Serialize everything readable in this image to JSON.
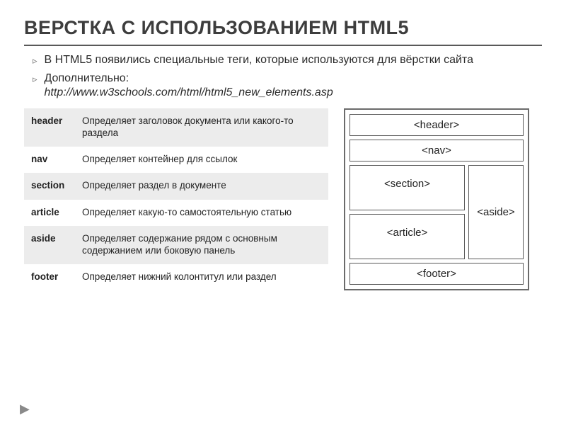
{
  "title": "ВЕРСТКА С ИСПОЛЬЗОВАНИЕМ HTML5",
  "bullets": [
    "В HTML5 появились специальные теги, которые используются для вёрстки сайта",
    "Дополнительно:"
  ],
  "ref_link": "http://www.w3schools.com/html/html5_new_elements.asp",
  "table": [
    {
      "tag": "header",
      "desc": "Определяет заголовок документа или какого-то раздела"
    },
    {
      "tag": "nav",
      "desc": "Определяет контейнер для ссылок"
    },
    {
      "tag": "section",
      "desc": "Определяет раздел в документе"
    },
    {
      "tag": "article",
      "desc": "Определяет какую-то самостоятельную статью"
    },
    {
      "tag": "aside",
      "desc": "Определяет содержание рядом с основным содержанием или боковую панель"
    },
    {
      "tag": "footer",
      "desc": "Определяет нижний колонтитул или раздел"
    }
  ],
  "diagram": {
    "header": "<header>",
    "nav": "<nav>",
    "section": "<section>",
    "article": "<article>",
    "aside": "<aside>",
    "footer": "<footer>"
  }
}
